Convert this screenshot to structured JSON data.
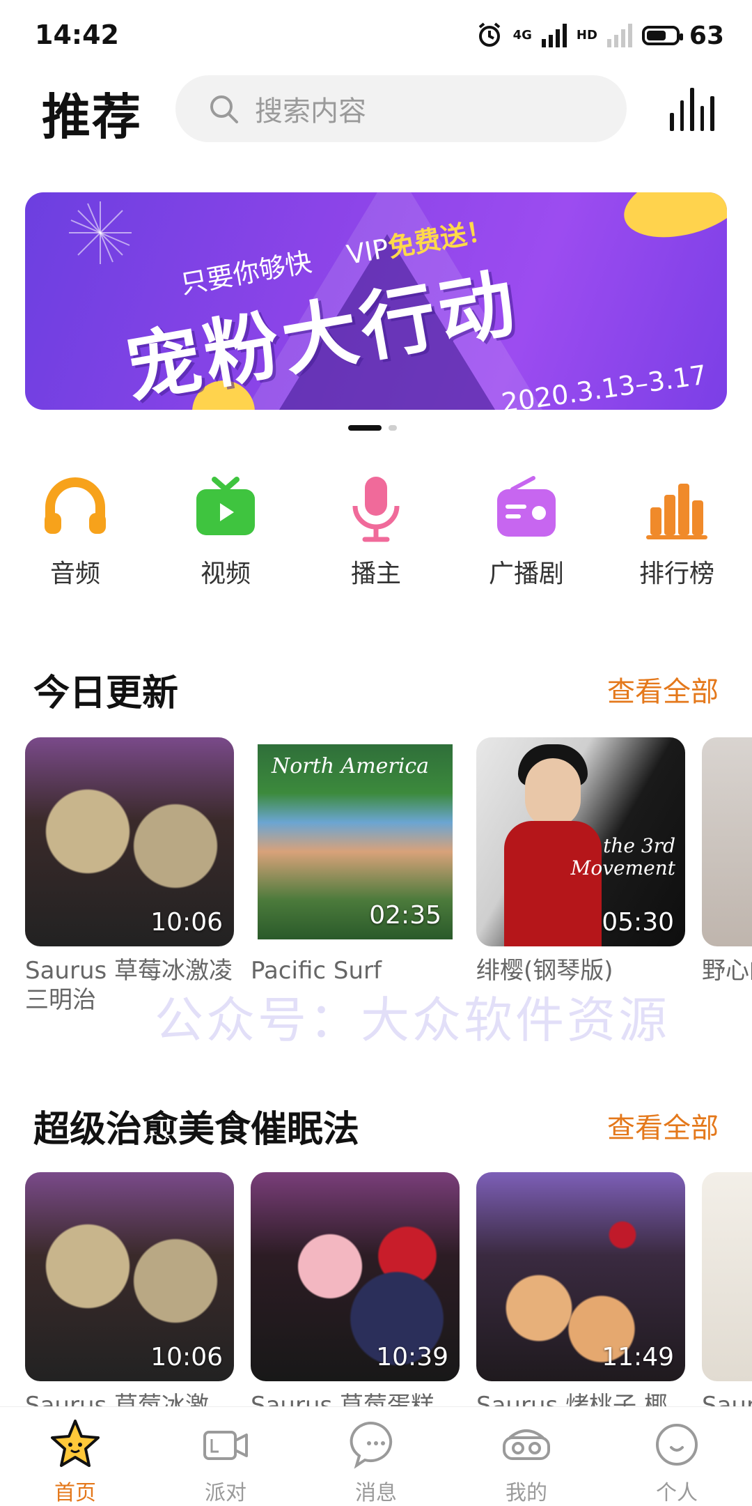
{
  "status_bar": {
    "time": "14:42",
    "net1": "4G",
    "net2": "HD",
    "battery": "63"
  },
  "header": {
    "title": "推荐",
    "search_placeholder": "搜索内容"
  },
  "banner": {
    "subtitle_a": "只要你够快",
    "subtitle_vip": "VIP",
    "subtitle_b": "免费送！",
    "headline": "宠粉大行动",
    "date": "2020.3.13–3.17",
    "slides_total": 2,
    "slide_active": 1
  },
  "categories": [
    {
      "label": "音频",
      "icon": "headphones-icon",
      "color": "#f7a21b"
    },
    {
      "label": "视频",
      "icon": "tv-icon",
      "color": "#3fc43f"
    },
    {
      "label": "播主",
      "icon": "microphone-icon",
      "color": "#f06a9a"
    },
    {
      "label": "广播剧",
      "icon": "radio-icon",
      "color": "#c766f0"
    },
    {
      "label": "排行榜",
      "icon": "bar-chart-icon",
      "color": "#f08a2a"
    }
  ],
  "sections": [
    {
      "title": "今日更新",
      "more": "查看全部",
      "items": [
        {
          "title": "Saurus 草莓冰激凌三明治",
          "duration": "10:06"
        },
        {
          "title": "Pacific Surf",
          "duration": "02:35",
          "cover_text": "North America"
        },
        {
          "title": "绯樱(钢琴版)",
          "duration": "05:30",
          "cover_text_1": "the 3rd",
          "cover_text_2": "Movement"
        },
        {
          "title": "野心的全",
          "duration": ""
        }
      ]
    },
    {
      "title": "超级治愈美食催眠法",
      "more": "查看全部",
      "items": [
        {
          "title": "Saurus 草莓冰激",
          "duration": "10:06"
        },
        {
          "title": "Saurus 草莓蛋糕",
          "duration": "10:39"
        },
        {
          "title": "Saurus 烤桃子 椰",
          "duration": "11:49"
        },
        {
          "title": "Saur",
          "duration": ""
        }
      ]
    }
  ],
  "watermark": "公众号：大众软件资源",
  "tabbar": [
    {
      "label": "首页",
      "icon": "star-face-icon",
      "active": true
    },
    {
      "label": "派对",
      "icon": "video-camera-icon",
      "active": false
    },
    {
      "label": "消息",
      "icon": "chat-bubble-icon",
      "active": false
    },
    {
      "label": "我的",
      "icon": "vr-goggles-icon",
      "active": false
    },
    {
      "label": "个人",
      "icon": "smile-face-icon",
      "active": false
    }
  ],
  "colors": {
    "accent": "#e4781b",
    "banner": "#8b44e8"
  }
}
